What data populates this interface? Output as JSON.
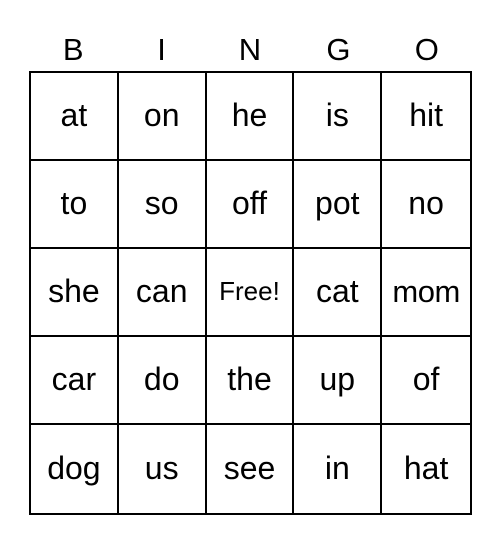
{
  "header": {
    "letters": [
      "B",
      "I",
      "N",
      "G",
      "O"
    ]
  },
  "board": {
    "rows": [
      [
        "at",
        "on",
        "he",
        "is",
        "hit"
      ],
      [
        "to",
        "so",
        "off",
        "pot",
        "no"
      ],
      [
        "she",
        "can",
        "Free!",
        "cat",
        "mom"
      ],
      [
        "car",
        "do",
        "the",
        "up",
        "of"
      ],
      [
        "dog",
        "us",
        "see",
        "in",
        "hat"
      ]
    ],
    "free_space_label": "Free!"
  },
  "colors": {
    "text": "#000000",
    "grid_lines": "#000000",
    "background": "#ffffff"
  }
}
